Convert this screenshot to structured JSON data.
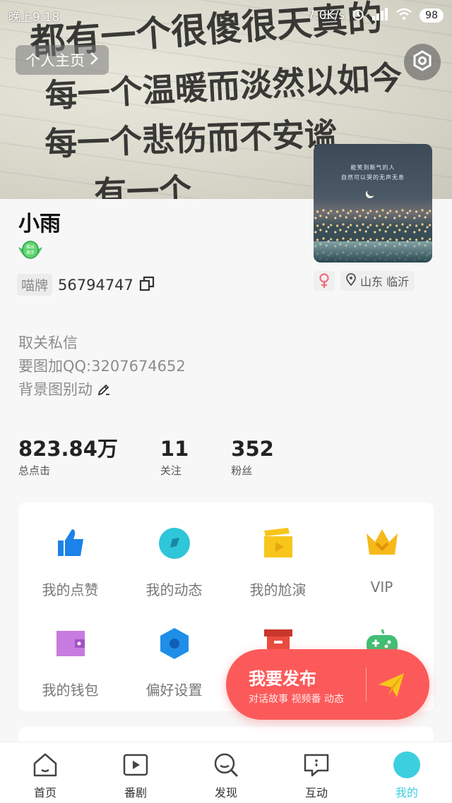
{
  "status_bar": {
    "time": "晚上9:18",
    "net_speed": "7.0K/s",
    "battery": "98"
  },
  "cover": {
    "handwriting": [
      "都有一个很傻很天真的",
      "每一个温暖而淡然以如今",
      "每一个悲伤而不安谧",
      "有一个"
    ]
  },
  "header": {
    "profile_label": "个人主页"
  },
  "avatar": {
    "line1": "能笑到断气的人",
    "line2": "自然可以哭的无声无息"
  },
  "user": {
    "name": "小雨",
    "badge_text": "猫出捕手",
    "id_tag": "喵牌",
    "id_number": "56794747",
    "location": "山东 临沂",
    "bio": [
      "取关私信",
      "要图加QQ:3207674652",
      "背景图别动"
    ]
  },
  "stats": [
    {
      "value": "823.84万",
      "label": "总点击"
    },
    {
      "value": "11",
      "label": "关注"
    },
    {
      "value": "352",
      "label": "粉丝"
    }
  ],
  "menu": [
    {
      "label": "我的点赞",
      "icon": "thumbs-up-icon"
    },
    {
      "label": "我的动态",
      "icon": "compass-icon"
    },
    {
      "label": "我的尬演",
      "icon": "clapperboard-icon"
    },
    {
      "label": "VIP",
      "icon": "crown-icon"
    },
    {
      "label": "我的钱包",
      "icon": "wallet-icon"
    },
    {
      "label": "偏好设置",
      "icon": "hexagon-settings-icon"
    },
    {
      "label": "",
      "icon": "mailbox-icon"
    },
    {
      "label": "",
      "icon": "gamepad-icon"
    }
  ],
  "fab": {
    "title": "我要发布",
    "subtitle": "对话故事  视频番  动态"
  },
  "tabs": [
    {
      "label": "首页",
      "icon": "home-icon"
    },
    {
      "label": "番剧",
      "icon": "play-icon"
    },
    {
      "label": "发现",
      "icon": "search-icon"
    },
    {
      "label": "互动",
      "icon": "message-icon"
    },
    {
      "label": "我的",
      "icon": "profile-icon",
      "active": true
    }
  ],
  "colors": {
    "accent": "#3ccfe0",
    "fab": "#fc5a5a",
    "thumb": "#1a82e8",
    "compass": "#2ec6d9",
    "clapper": "#f8c61a",
    "crown": "#f6b91a",
    "wallet": "#c77be0",
    "hexagon": "#1e8ee8",
    "mailbox": "#e94c3d",
    "gamepad": "#3fbf74"
  }
}
